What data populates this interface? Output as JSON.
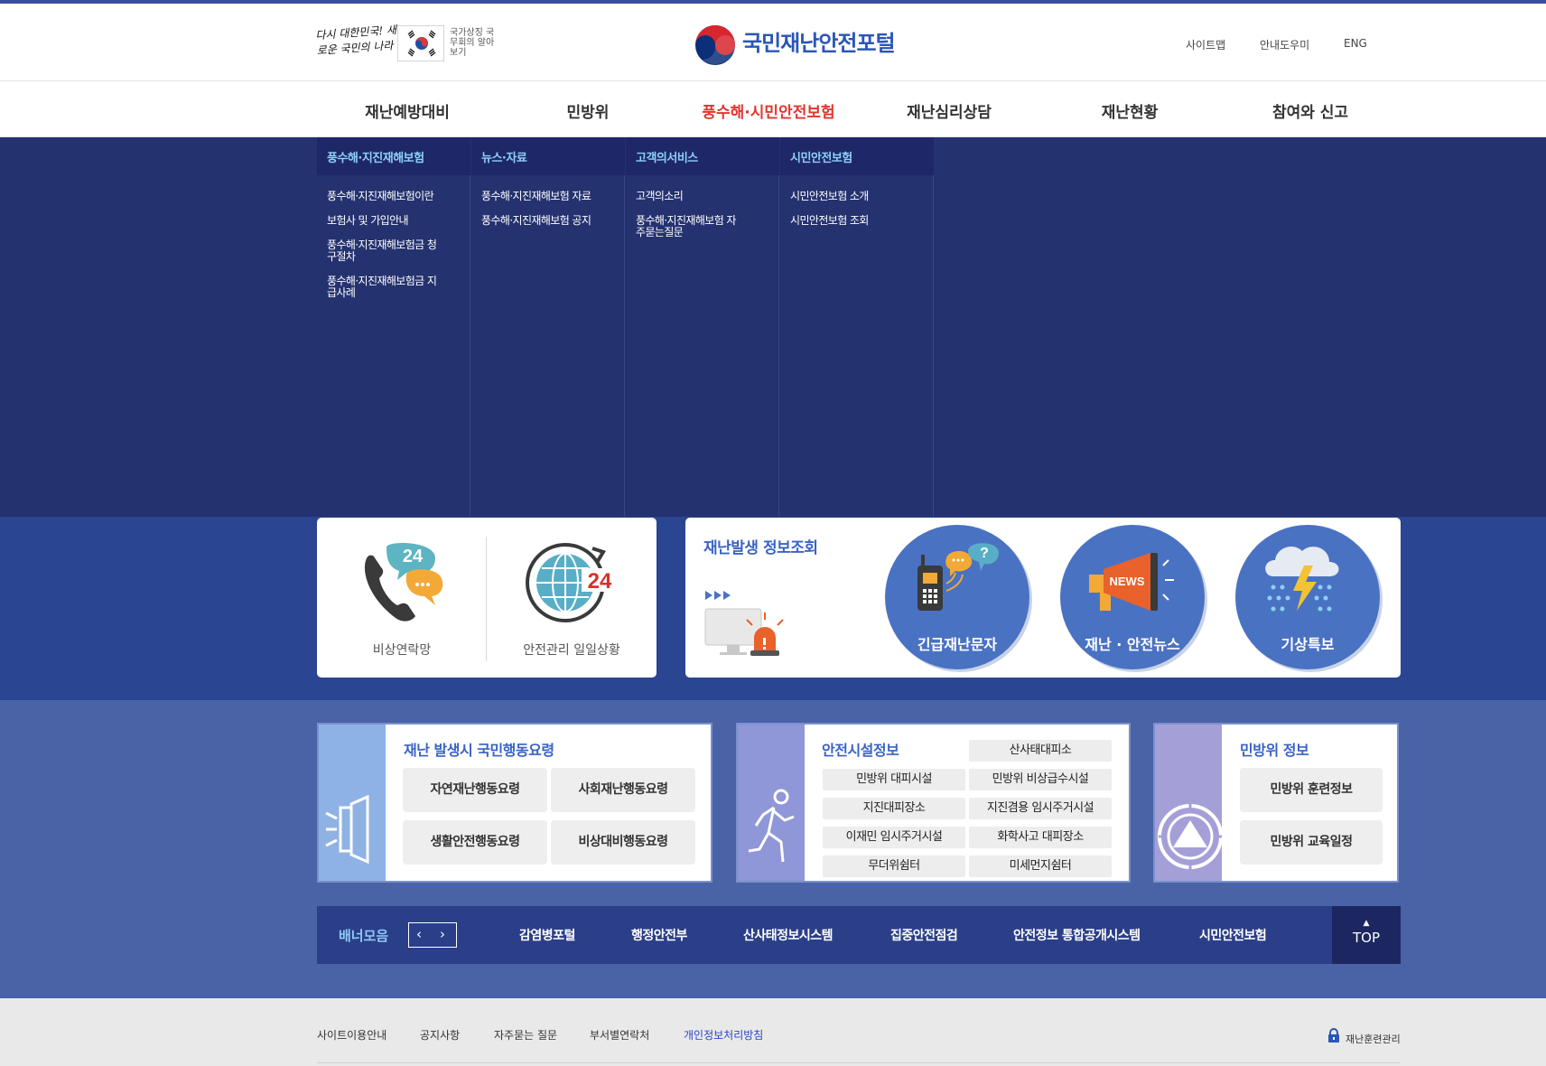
{
  "header": {
    "slogan": "다시 대한민국! 새로운 국민의 나라",
    "flag_caption": "국가상징 국무회의 알아보기",
    "logo_text": "국민재난안전포털",
    "util_links": [
      "사이트맵",
      "안내도우미",
      "ENG"
    ]
  },
  "gnb": {
    "items": [
      "재난예방대비",
      "민방위",
      "풍수해·시민안전보험",
      "재난심리상담",
      "재난현황",
      "참여와 신고"
    ],
    "active": "풍수해·시민안전보험"
  },
  "mega_menu": {
    "columns": [
      {
        "title": "풍수해·지진재해보험",
        "links": [
          "풍수해·지진재해보험이란",
          "보험사 및 가입안내",
          "풍수해·지진재해보험금 청구절차",
          "풍수해·지진재해보험금 지급사례"
        ]
      },
      {
        "title": "뉴스·자료",
        "links": [
          "풍수해·지진재해보험 자료",
          "풍수해·지진재해보험 공지"
        ]
      },
      {
        "title": "고객의서비스",
        "links": [
          "고객의소리",
          "풍수해·지진재해보험 자주묻는질문"
        ]
      },
      {
        "title": "시민안전보험",
        "links": [
          "시민안전보험 소개",
          "시민안전보험 조회"
        ]
      }
    ]
  },
  "quick": {
    "emergency_contacts": "비상연락망",
    "daily_status": "안전관리 일일상황",
    "daily_status_badge": "24",
    "contacts_badge": "24"
  },
  "disaster_info": {
    "title": "재난발생 정보조회",
    "buttons": [
      {
        "label": "긴급재난문자",
        "icon": "walkie-talkie-icon"
      },
      {
        "label": "재난 · 안전뉴스",
        "icon": "megaphone-news-icon",
        "badge": "NEWS"
      },
      {
        "label": "기상특보",
        "icon": "storm-cloud-icon"
      }
    ]
  },
  "panels": {
    "action": {
      "title": "재난 발생시 국민행동요령",
      "buttons": [
        "자연재난행동요령",
        "사회재난행동요령",
        "생활안전행동요령",
        "비상대비행동요령"
      ]
    },
    "facility": {
      "title": "안전시설정보",
      "buttons": [
        "산사태대피소",
        "민방위 대피시설",
        "민방위 비상급수시설",
        "지진대피장소",
        "지진겸용 임시주거시설",
        "이재민 임시주거시설",
        "화학사고 대피장소",
        "무더위쉼터",
        "미세먼지쉼터"
      ]
    },
    "civil": {
      "title": "민방위 정보",
      "buttons": [
        "민방위 훈련정보",
        "민방위 교육일정"
      ]
    }
  },
  "banner": {
    "title": "배너모음",
    "prev": "‹",
    "next": "›",
    "links": [
      "감염병포털",
      "행정안전부",
      "산사태정보시스템",
      "집중안전점검",
      "안전정보 통합공개시스템",
      "시민안전보험"
    ],
    "top_label": "TOP"
  },
  "footer": {
    "links": [
      "사이트이용안내",
      "공지사항",
      "자주묻는 질문",
      "부서별연락처",
      "개인정보처리방침"
    ],
    "highlight": "개인정보처리방침",
    "training_admin": "재난훈련관리"
  },
  "colors": {
    "primary_navy": "#253270",
    "accent_red": "#e4342e",
    "link_blue": "#2a56b8",
    "circle_blue": "#4a72c2"
  }
}
